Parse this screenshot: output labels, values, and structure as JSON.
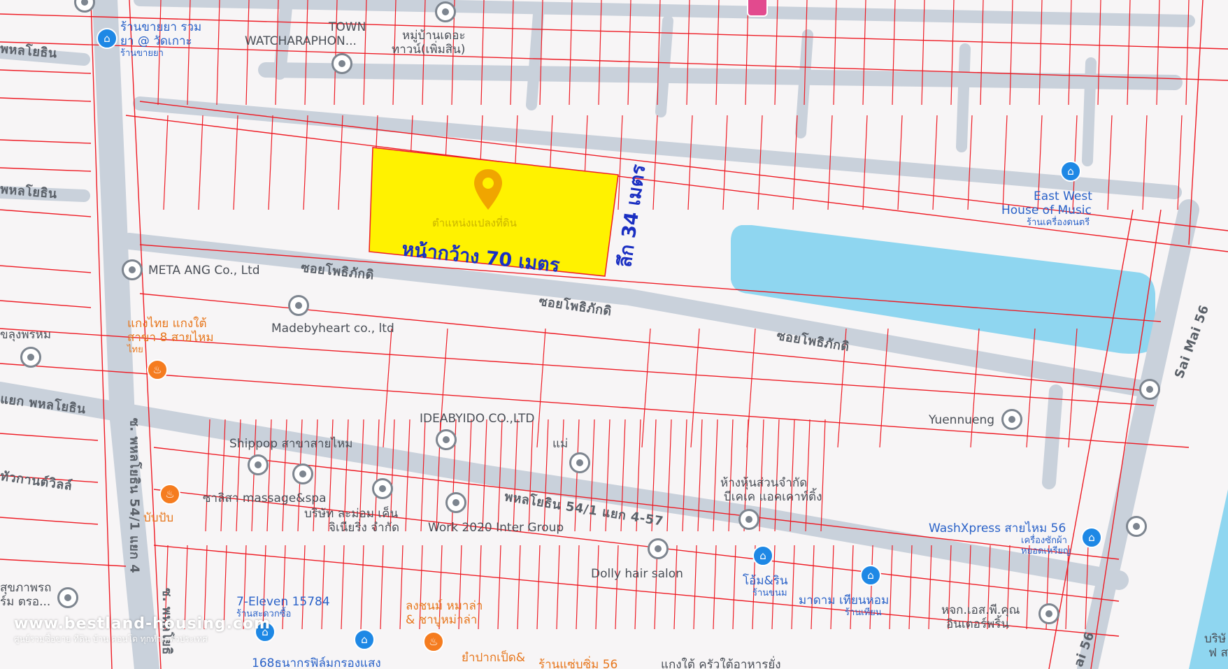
{
  "plot": {
    "label": "ตำแหน่งแปลงที่ดิน",
    "width_label": "หน้ากว้าง 70 เมตร",
    "depth_label": "ลึก 34 เมตร",
    "fill_color": "#fff200",
    "pin_color": "#f0a500"
  },
  "colors": {
    "road": "#c9d1db",
    "parcel_line": "#ee1c25",
    "water": "#8fd6f0",
    "background": "#f7f5f6",
    "dimension_text": "#1a2fc2"
  },
  "roads": {
    "soi_1": "ซอยโพธิภักดิ",
    "soi_2": "ซอยโพธิภักดิ",
    "soi_3": "ซอยโพธิภักดิ",
    "phahon_1": "พหลโยธิน",
    "phahon_2": "พหลโยธิน",
    "phahon_3": "แยก พหลโยธิน",
    "main_vertical": "ซ. พหลโยธิน 54/1 แยก 4",
    "main_vertical_2": "ซ. พหลโยธิ",
    "lower_road": "พหลโยธิน 54/1 แยก 4-57",
    "sai_mai_56": "Sai Mai 56",
    "sai_mai_56_b": "ai 56",
    "kan_villa": "ทัวกานต์วิลล์"
  },
  "pois": {
    "pharmacy": "ร้านขายยา รวม",
    "pharmacy_2": "ยา @ วัดเกาะ",
    "pharmacy_3": "ร้านขายยา",
    "town_1": "TOWN",
    "town_2": "WATCHARAPHON...",
    "village_1": "หมู่บ้านเดอะ",
    "village_2": "ทาวน์(เพิ่มสิน)",
    "meta_ang": "META ANG Co., Ltd",
    "madebyheart": "Madebyheart co., ltd",
    "kaeng_thai_1": "แกงไทย แกงใต้",
    "kaeng_thai_2": "สาขา 8 สายไหม",
    "kaeng_thai_3": "ไทย",
    "lung_phrom": "ขลุงพรหม",
    "east_west_1": "East West",
    "east_west_2": "House of Music",
    "east_west_3": "ร้านเครื่องดนตรี",
    "ideabyido": "IDEABYIDO CO.,LTD",
    "shippop": "Shippop สาขาสายไหม",
    "mae": "แม่",
    "salisa": "ซาลิสา massage&spa",
    "company_1": "บริษัท ละม่อม เค็น",
    "company_2": "จิเนียริ่ง จำกัด",
    "work2020": "Work 2020 Inter Group",
    "bubpub": "บับปับ",
    "yuennueng": "Yuennueng",
    "partnership_1": "ห้างหุ้นส่วนจำกัด",
    "partnership_2": "บีเคเค แอคเคาท์ติ้ง",
    "washxpress": "WashXpress สายไหม 56",
    "washxpress_2": "เครื่องซักผ้า",
    "washxpress_3": "หยอดเหรียญ",
    "dolly": "Dolly hair salon",
    "tom_rin": "โอ้ม&ริน",
    "tom_rin_2": "ร้านขนม",
    "madam": "มาดาม เทียนหอม",
    "madam_2": "ร้านเทียน",
    "hjk": "หจก.เอส.พี.คุณ",
    "hjk_2": "อินเตอร์พริ้น",
    "seven_eleven": "7-Eleven 15784",
    "seven_eleven_2": "ร้านสะดวกซื้อ",
    "longchon_1": "ลงชนม์ หมาล่า",
    "longchon_2": "& ชาบูหม่าล่า",
    "photo_168": "168ธนากรฟิล์มกรองแสง",
    "yam": "ยำปากเป็ด&",
    "shop_56": "ร้านแซ่บซิ่ม 56",
    "kaeng_tai_2": "แกงใต้ ครัวใต้อาหารยั่ง",
    "left_1": "สุขภาพรถ",
    "left_2": "ร์ม ตรอ...",
    "right_1": "บริษั",
    "right_2": "ฟ ส",
    "top_pink": "",
    "right_circle": ""
  },
  "watermark": {
    "url": "www.bestland-housing.com",
    "tagline": "ศูนย์รวมซื้อขาย ที่ดิน บ้าน คอนโด ทุกทำเลทั่วประเทศ"
  },
  "icons": {
    "grey_pin": "place-pin-icon",
    "blue_pin": "shop-pin-icon",
    "orange_pin": "restaurant-pin-icon",
    "location": "location-marker-icon"
  }
}
